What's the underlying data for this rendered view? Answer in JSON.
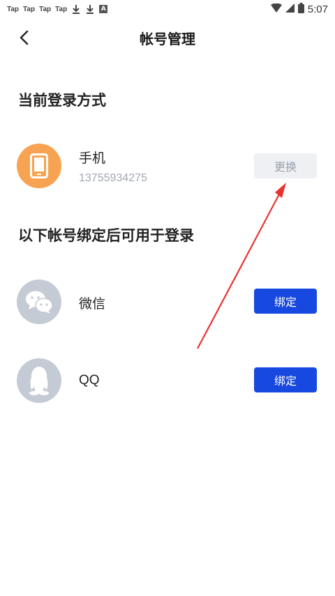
{
  "status_bar": {
    "notifications": [
      "Tap",
      "Tap",
      "Tap",
      "Tap"
    ],
    "time": "5:07",
    "icons": [
      "download-icon",
      "download-icon",
      "a-icon",
      "wifi-icon",
      "signal-icon",
      "battery-icon"
    ]
  },
  "header": {
    "title": "帐号管理",
    "back_icon": "chevron-left-icon"
  },
  "current_login": {
    "section_title": "当前登录方式",
    "method_label": "手机",
    "phone_number": "13755934275",
    "change_button": "更换",
    "icon": "phone-icon"
  },
  "bind_accounts": {
    "section_title": "以下帐号绑定后可用于登录",
    "items": [
      {
        "label": "微信",
        "button": "绑定",
        "icon": "wechat-icon"
      },
      {
        "label": "QQ",
        "button": "绑定",
        "icon": "qq-icon"
      }
    ]
  },
  "colors": {
    "primary_button": "#1748e0",
    "disabled_button_bg": "#eef0f3",
    "phone_avatar": "#f8a351",
    "gray_avatar": "#c5cbd4",
    "annotation_arrow": "#e8322f"
  }
}
